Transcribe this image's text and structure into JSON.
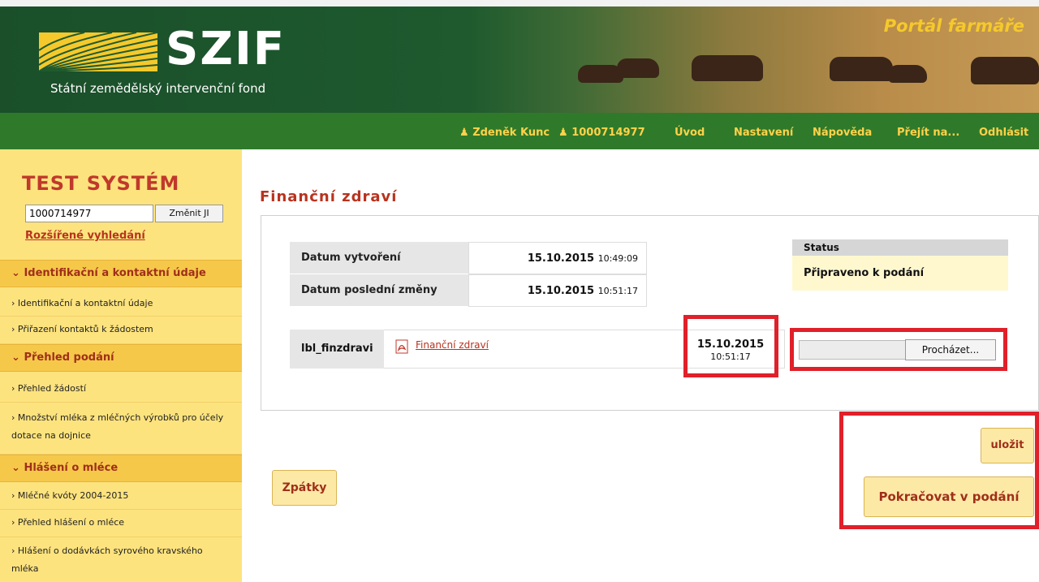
{
  "header": {
    "logo_text": "SZIF",
    "logo_subtitle": "Státní zemědělský intervenční fond",
    "portal_title": "Portál farmáře"
  },
  "nav": {
    "user": "Zdeněk Kunc",
    "id": "1000714977",
    "items": [
      "Úvod",
      "Nastavení",
      "Nápověda",
      "Přejít na...",
      "Odhlásit"
    ]
  },
  "sidebar": {
    "system_title": "TEST SYSTÉM",
    "ji_value": "1000714977",
    "change_button": "Změnit JI",
    "advanced_search": "Rozšířené vyhledání",
    "sections": [
      {
        "title": "Identifikační a kontaktní údaje",
        "items": [
          "Identifikační a kontaktní údaje",
          "Přiřazení kontaktů k žádostem"
        ]
      },
      {
        "title": "Přehled podání",
        "items": [
          "Přehled žádostí",
          "Množství mléka z mléčných výrobků pro účely dotace na dojnice"
        ]
      },
      {
        "title": "Hlášení o mléce",
        "items": [
          "Mléčné kvóty 2004-2015",
          "Přehled hlášení o mléce",
          "Hlášení o dodávkách syrového kravského mléka"
        ]
      }
    ]
  },
  "main": {
    "title": "Finanční zdraví",
    "created_label": "Datum vytvoření",
    "created_date": "15.10.2015",
    "created_time": "10:49:09",
    "modified_label": "Datum poslední změny",
    "modified_date": "15.10.2015",
    "modified_time": "10:51:17",
    "status_header": "Status",
    "status_value": "Připraveno k podání",
    "file_label": "lbl_finzdravi",
    "file_link": "Finanční zdraví",
    "file_date": "15.10.2015",
    "file_time": "10:51:17",
    "browse_button": "Procházet...",
    "save_button": "uložit",
    "back_button": "Zpátky",
    "continue_button": "Pokračovat v podání"
  },
  "colors": {
    "accent_red": "#b8331f",
    "nav_green": "#2f7a2a",
    "nav_text": "#ffd24a",
    "sidebar_yellow": "#fde37e",
    "highlight_red": "#e0202a"
  }
}
